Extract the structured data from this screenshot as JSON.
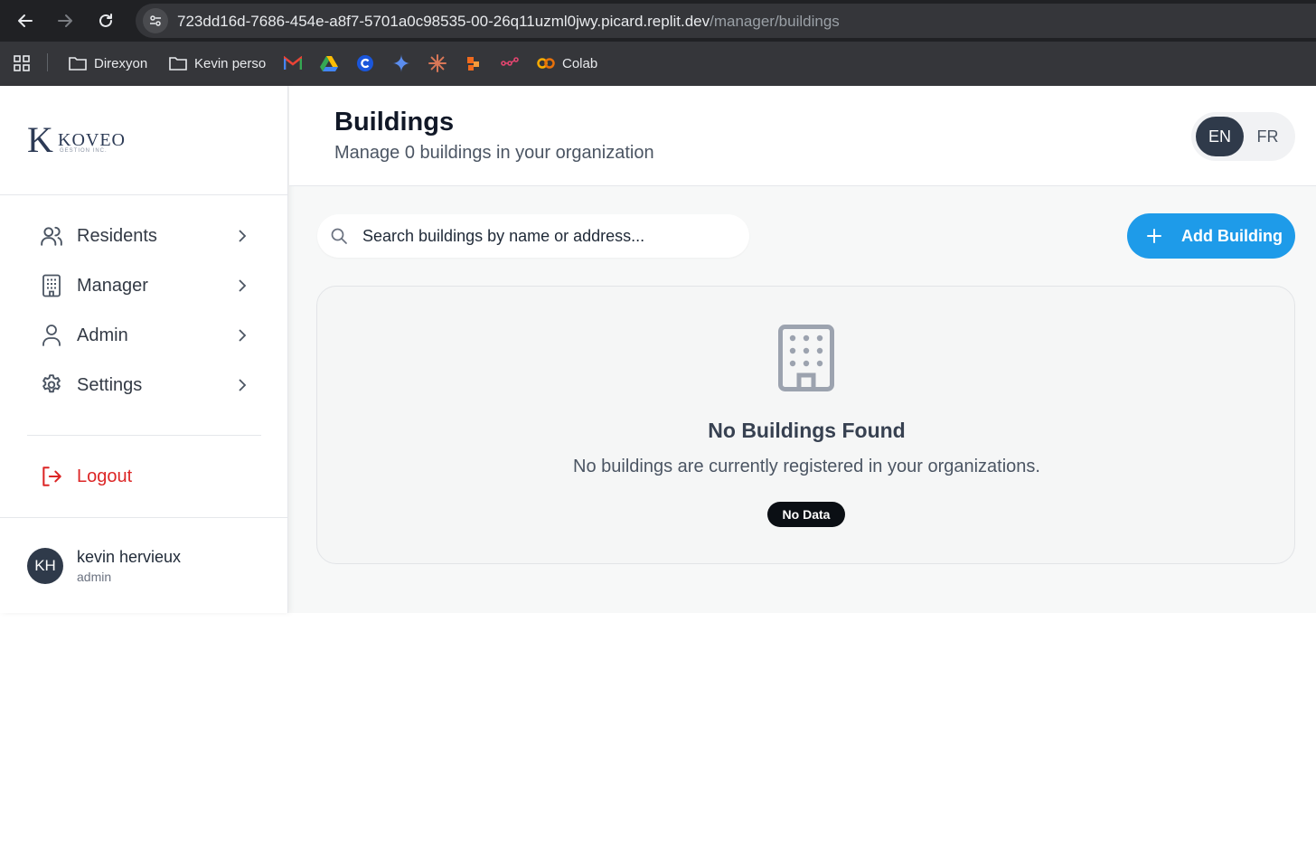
{
  "browser": {
    "url_host": "723dd16d-7686-454e-a8f7-5701a0c98535-00-26q11uzml0jwy.picard.replit.dev",
    "url_path": "/manager/buildings",
    "bookmarks": [
      {
        "label": "Direxyon",
        "icon": "folder-icon"
      },
      {
        "label": "Kevin perso",
        "icon": "folder-icon"
      },
      {
        "label": "",
        "icon": "gmail-icon"
      },
      {
        "label": "",
        "icon": "google-drive-icon"
      },
      {
        "label": "",
        "icon": "c-icon"
      },
      {
        "label": "",
        "icon": "gemini-icon"
      },
      {
        "label": "",
        "icon": "claude-icon"
      },
      {
        "label": "",
        "icon": "orange-app-icon"
      },
      {
        "label": "",
        "icon": "pink-app-icon"
      },
      {
        "label": "Colab",
        "icon": "colab-icon"
      }
    ]
  },
  "brand": {
    "logo_letter": "K",
    "logo_word": "KOVEO",
    "logo_sub": "GESTION INC."
  },
  "sidebar": {
    "items": [
      {
        "label": "Residents",
        "icon": "users-icon"
      },
      {
        "label": "Manager",
        "icon": "building-icon"
      },
      {
        "label": "Admin",
        "icon": "user-icon"
      },
      {
        "label": "Settings",
        "icon": "gear-icon"
      }
    ],
    "logout_label": "Logout",
    "user": {
      "initials": "KH",
      "name": "kevin hervieux",
      "role": "admin"
    }
  },
  "header": {
    "title": "Buildings",
    "subtitle": "Manage 0 buildings in your organization",
    "lang_en": "EN",
    "lang_fr": "FR",
    "active_lang": "EN"
  },
  "toolbar": {
    "search_placeholder": "Search buildings by name or address...",
    "add_label": "Add Building"
  },
  "empty_state": {
    "title": "No Buildings Found",
    "message": "No buildings are currently registered in your organizations.",
    "badge": "No Data"
  },
  "colors": {
    "accent": "#1e9be9",
    "logout": "#dc2626",
    "dark": "#2f3a4a"
  }
}
